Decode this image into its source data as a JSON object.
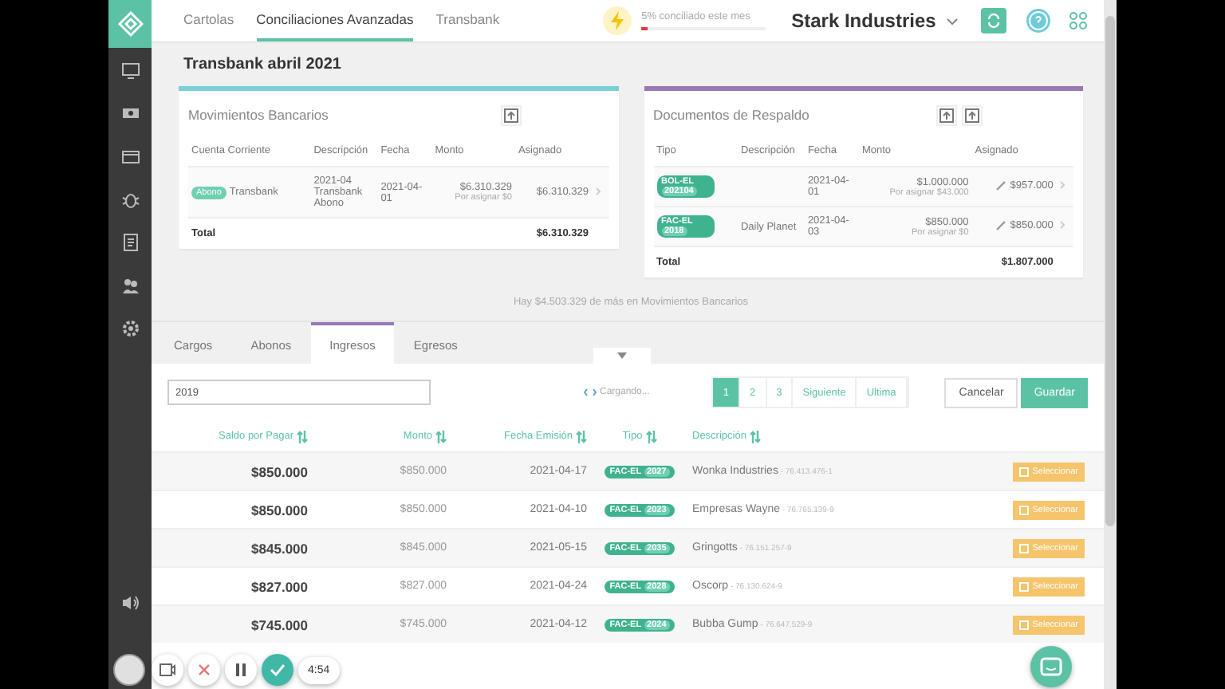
{
  "top_nav": {
    "tabs": [
      {
        "label": "Cartolas",
        "selected": false
      },
      {
        "label": "Conciliaciones Avanzadas",
        "selected": true
      },
      {
        "label": "Transbank",
        "selected": false
      }
    ],
    "progress": {
      "label": "5% conciliado este mes",
      "level": 0.05
    },
    "company": "Stark Industries"
  },
  "page_title": "Transbank abril 2021",
  "bank_card": {
    "title": "Movimientos Bancarios",
    "columns": [
      "Cuenta Corriente",
      "Descripción",
      "Fecha",
      "Monto",
      "Asignado"
    ],
    "rows": [
      {
        "tag": "Abono",
        "account": "Transbank",
        "description": "2021-04 Transbank Abono",
        "date": "2021-04-01",
        "amount": "$6.310.329",
        "pending": "Por asignar $0",
        "assigned": "$6.310.329"
      }
    ],
    "total_label": "Total",
    "total": "$6.310.329"
  },
  "docs_card": {
    "title": "Documentos de Respaldo",
    "columns": [
      "Tipo",
      "Descripción",
      "Fecha",
      "Monto",
      "Asignado"
    ],
    "rows": [
      {
        "type": "BOL-EL",
        "number": "202104",
        "date": "2021-04-01",
        "amount": "$1.000.000",
        "pending": "Por asignar $43.000",
        "assigned": "$957.000"
      },
      {
        "type": "FAC-EL",
        "number": "2018",
        "description": "Daily Planet",
        "date": "2021-04-03",
        "amount": "$850.000",
        "pending": "Por asignar $0",
        "assigned": "$850.000"
      }
    ],
    "total_label": "Total",
    "total": "$1.807.000"
  },
  "note": "Hay $4.503.329 de más en Movimientos Bancarios",
  "detail_tabs": [
    {
      "label": "Cargos",
      "selected": false
    },
    {
      "label": "Abonos",
      "selected": false
    },
    {
      "label": "Ingresos",
      "selected": true
    },
    {
      "label": "Egresos",
      "selected": false
    }
  ],
  "search": {
    "value": "2019"
  },
  "loading": "Cargando...",
  "pagination": [
    {
      "label": "1",
      "selected": true
    },
    {
      "label": "2",
      "selected": false
    },
    {
      "label": "3",
      "selected": false
    },
    {
      "label": "Siguiente",
      "selected": false
    },
    {
      "label": "Ultima",
      "selected": false
    }
  ],
  "buttons": [
    {
      "label": "Cancelar",
      "kind": "secondary"
    },
    {
      "label": "Guardar",
      "kind": "primary"
    }
  ],
  "table": {
    "columns": [
      "Saldo por Pagar",
      "Monto",
      "Fecha Emisión",
      "Tipo",
      "Descripción"
    ],
    "rows": [
      {
        "balance": "$850.000",
        "amount": "$850.000",
        "date": "2021-04-17",
        "type": "FAC-EL",
        "number": "2027",
        "name": "Wonka Industries",
        "rut": " - 76.413.476-1",
        "action": "Seleccionar"
      },
      {
        "balance": "$850.000",
        "amount": "$850.000",
        "date": "2021-04-10",
        "type": "FAC-EL",
        "number": "2023",
        "name": "Empresas Wayne",
        "rut": " - 76.765.139-9",
        "action": "Seleccionar"
      },
      {
        "balance": "$845.000",
        "amount": "$845.000",
        "date": "2021-05-15",
        "type": "FAC-EL",
        "number": "2035",
        "name": "Gringotts",
        "rut": " - 76.151.257-9",
        "action": "Seleccionar"
      },
      {
        "balance": "$827.000",
        "amount": "$827.000",
        "date": "2021-04-24",
        "type": "FAC-EL",
        "number": "2028",
        "name": "Oscorp",
        "rut": " - 76.130.624-9",
        "action": "Seleccionar"
      },
      {
        "balance": "$745.000",
        "amount": "$745.000",
        "date": "2021-04-12",
        "type": "FAC-EL",
        "number": "2024",
        "name": "Bubba Gump",
        "rut": " - 76.647.529-9",
        "action": "Seleccionar"
      }
    ]
  },
  "recorder": {
    "time": "4:54"
  }
}
